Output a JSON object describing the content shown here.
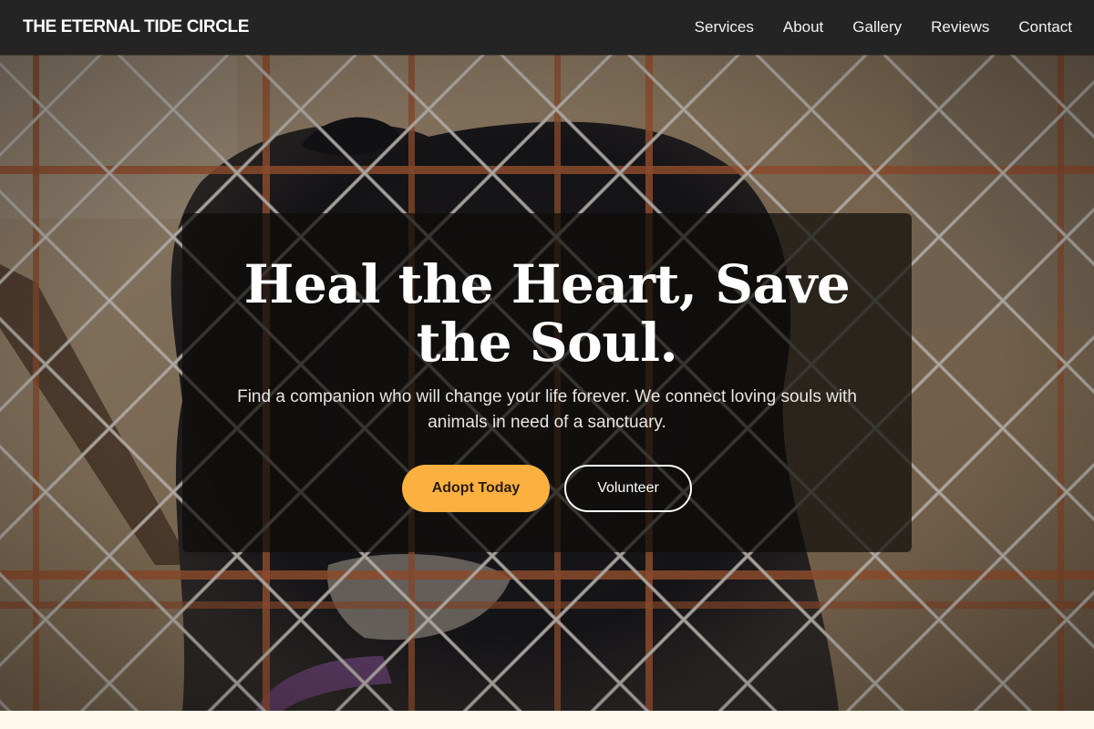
{
  "brand": {
    "name": "THE ETERNAL TIDE CIRCLE"
  },
  "nav": {
    "links": [
      {
        "label": "Services"
      },
      {
        "label": "About"
      },
      {
        "label": "Gallery"
      },
      {
        "label": "Reviews"
      },
      {
        "label": "Contact"
      }
    ]
  },
  "hero": {
    "title": "Heal the Heart, Save the Soul.",
    "subtitle": "Find a companion who will change your life forever. We connect loving souls with animals in need of a sanctuary.",
    "primary_button": "Adopt Today",
    "secondary_button": "Volunteer"
  },
  "colors": {
    "nav_background": "#242424",
    "accent": "#fbb040",
    "page_background": "#fff9ec"
  }
}
